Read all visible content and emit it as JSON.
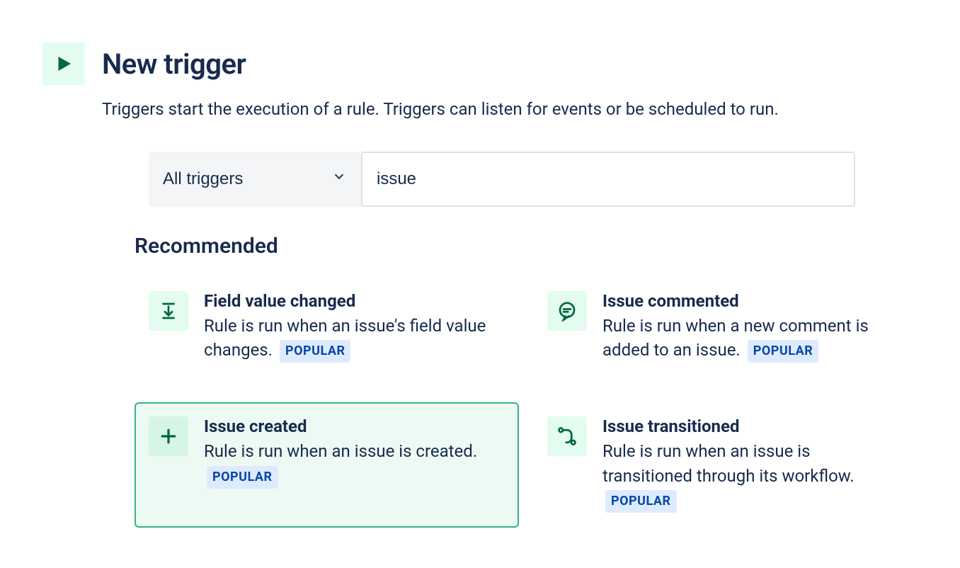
{
  "header": {
    "title": "New trigger",
    "subtitle": "Triggers start the execution of a rule. Triggers can listen for events or be scheduled to run."
  },
  "filter": {
    "dropdown_label": "All triggers",
    "search_value": "issue"
  },
  "section": {
    "heading": "Recommended"
  },
  "badge_label": "POPULAR",
  "cards": [
    {
      "title": "Field value changed",
      "description": "Rule is run when an issue's field value changes.",
      "icon": "field-value-icon",
      "popular": true,
      "selected": false
    },
    {
      "title": "Issue commented",
      "description": "Rule is run when a new comment is added to an issue.",
      "icon": "comment-icon",
      "popular": true,
      "selected": false
    },
    {
      "title": "Issue created",
      "description": "Rule is run when an issue is created.",
      "icon": "plus-icon",
      "popular": true,
      "selected": true
    },
    {
      "title": "Issue transitioned",
      "description": "Rule is run when an issue is transitioned through its workflow.",
      "icon": "transition-icon",
      "popular": true,
      "selected": false
    }
  ]
}
